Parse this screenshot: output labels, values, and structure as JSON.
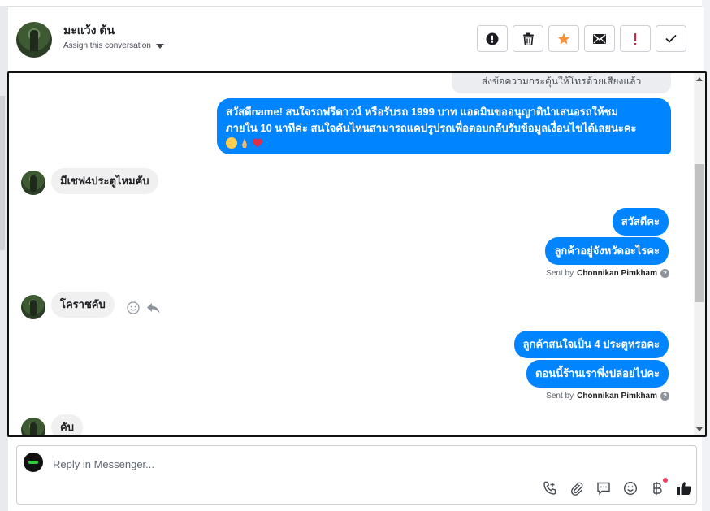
{
  "header": {
    "contact_name": "มะแว้ง ต้น",
    "assign_label": "Assign this conversation"
  },
  "conversation": {
    "notice": "ส่งข้อความกระตุ้นให้โทรด้วยเสียงแล้ว",
    "greeting_line1": "สวัสดีname! สนใจรถฟรีดาวน์ หรือรับรถ 1999 บาท แอดมินขออนุญาตินำเสนอรถให้ชม",
    "greeting_line2": "ภายใน 10 นาทีค่ะ สนใจคันไหนสามารถแคปรูปรถเพื่อตอบกลับรับข้อมูลเงื่อนไขได้เลยนะคะ",
    "msg_customer_1": "มีเชฟ4ประตูไหมคับ",
    "msg_agent_1": "สวัสดีคะ",
    "msg_agent_2": "ลูกค้าอยู่จังหวัดอะไรคะ",
    "sent_by_prefix": "Sent by",
    "agent_name": "Chonnikan Pimkham",
    "msg_customer_2": "โคราชคับ",
    "msg_agent_3": "ลูกค้าสนใจเป็น 4 ประตูหรอคะ",
    "msg_agent_4": "ตอนนี้ร้านเราพึ่งปล่อยไปคะ",
    "msg_customer_3": "คับ"
  },
  "reply": {
    "placeholder": "Reply in Messenger..."
  },
  "colors": {
    "accent": "#0084ff",
    "star": "#f7923a",
    "alert": "#e41e3f"
  }
}
